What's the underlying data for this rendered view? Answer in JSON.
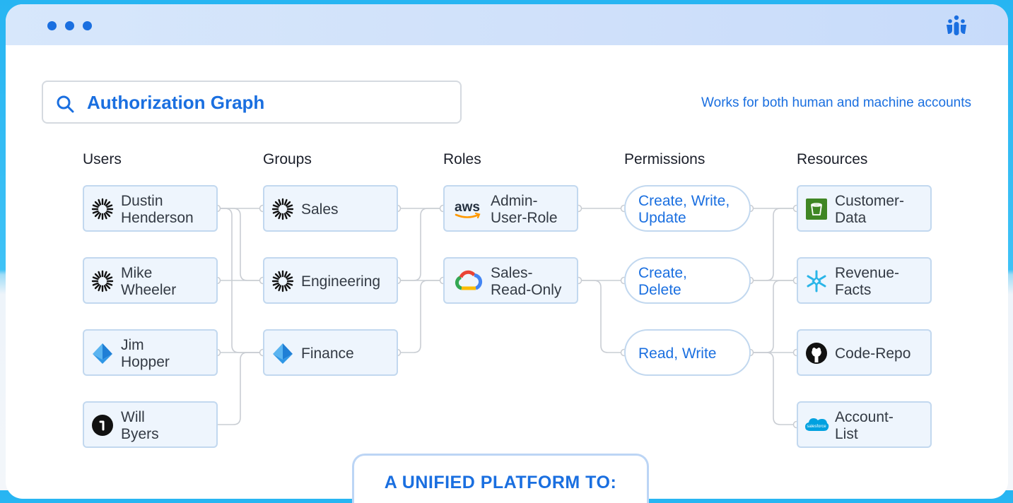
{
  "header": {
    "title": "Authorization Graph",
    "tagline": "Works for both human and machine accounts"
  },
  "columns": [
    "Users",
    "Groups",
    "Roles",
    "Permissions",
    "Resources"
  ],
  "users": [
    {
      "lines": [
        "Dustin",
        "Henderson"
      ],
      "icon": "sunburst-icon"
    },
    {
      "lines": [
        "Mike",
        "Wheeler"
      ],
      "icon": "sunburst-icon"
    },
    {
      "lines": [
        "Jim",
        "Hopper"
      ],
      "icon": "azure-pyramid-icon"
    },
    {
      "lines": [
        "Will",
        "Byers"
      ],
      "icon": "onelogin-icon"
    }
  ],
  "groups": [
    {
      "label": "Sales",
      "icon": "sunburst-icon"
    },
    {
      "label": "Engineering",
      "icon": "sunburst-icon"
    },
    {
      "label": "Finance",
      "icon": "azure-pyramid-icon"
    }
  ],
  "roles": [
    {
      "lines": [
        "Admin-",
        "User-Role"
      ],
      "icon": "aws-icon",
      "icon_text": "aws"
    },
    {
      "lines": [
        "Sales-",
        "Read-Only"
      ],
      "icon": "google-cloud-icon"
    }
  ],
  "permissions": [
    {
      "lines": [
        "Create, Write,",
        "Update"
      ]
    },
    {
      "lines": [
        "Create,",
        "Delete"
      ]
    },
    {
      "lines": [
        "Read, Write"
      ]
    }
  ],
  "resources": [
    {
      "lines": [
        "Customer-",
        "Data"
      ],
      "icon": "s3-bucket-icon"
    },
    {
      "lines": [
        "Revenue-",
        "Facts"
      ],
      "icon": "snowflake-icon"
    },
    {
      "lines": [
        "Code-Repo"
      ],
      "icon": "github-icon"
    },
    {
      "lines": [
        "Account-",
        "List"
      ],
      "icon": "salesforce-icon",
      "icon_text": "salesforce"
    }
  ],
  "footer": {
    "banner": "A UNIFIED PLATFORM TO:"
  },
  "colors": {
    "accent": "#1a6fe0",
    "node_bg": "#eef5fd",
    "node_border": "#c2d8ef",
    "edge": "#c9cdd3"
  }
}
